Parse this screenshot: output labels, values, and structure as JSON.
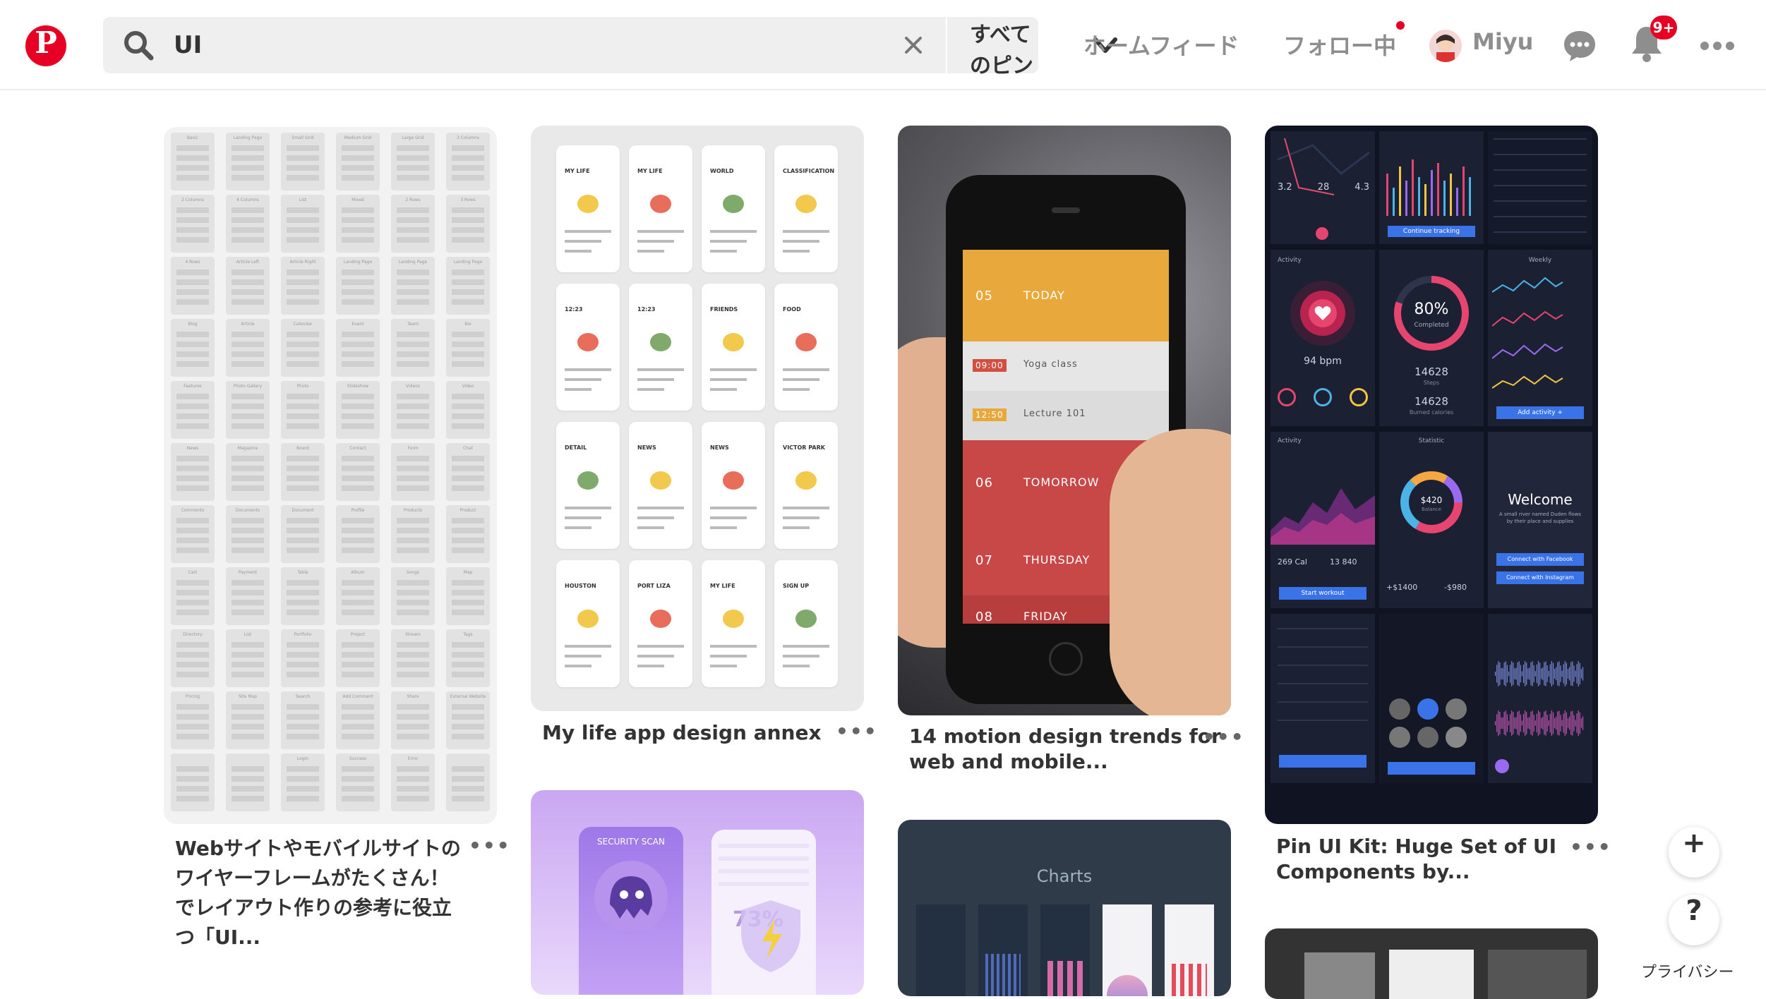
{
  "header": {
    "logo": "P",
    "search_value": "UI",
    "filter_label": "すべてのピン",
    "nav_home": "ホームフィード",
    "nav_following": "フォロー中",
    "user_name": "Miyu",
    "notification_badge": "9+"
  },
  "pins": [
    {
      "caption_lines": [
        "Webサイトやモバイルサイトの",
        "ワイヤーフレームがたくさん！",
        "でレイアウト作りの参考に役立",
        "つ「UI..."
      ]
    },
    {
      "caption": "My life app design annex"
    },
    {
      "caption_lines": [
        "14 motion design trends for",
        "web and mobile..."
      ]
    },
    {
      "caption_lines": [
        "Pin UI Kit: Huge Set of UI",
        "Components by..."
      ]
    }
  ],
  "phone_rows": [
    {
      "num": "05",
      "label": "TODAY"
    },
    {
      "time": "09:00",
      "label": "Yoga class"
    },
    {
      "time": "12:50",
      "label": "Lecture 101"
    },
    {
      "num": "06",
      "label": "TOMORROW"
    },
    {
      "num": "07",
      "label": "THURSDAY"
    },
    {
      "num": "08",
      "label": "FRIDAY"
    }
  ],
  "wireframe_labels": [
    [
      "Basic",
      "Landing Page",
      "Small Grid",
      "Medium Grid",
      "Large Grid",
      "3 Columns"
    ],
    [
      "2 Columns",
      "4 Columns",
      "List",
      "Mixed",
      "2 Rows",
      "3 Rows"
    ],
    [
      "4 Rows",
      "Article Left",
      "Article Right",
      "Landing Page",
      "Landing Page",
      "Landing Page"
    ],
    [
      "Blog",
      "Article",
      "Calendar",
      "Event",
      "Team",
      "Bio"
    ],
    [
      "Features",
      "Photo Gallery",
      "Photo",
      "Slideshow",
      "Videos",
      "Video"
    ],
    [
      "News",
      "Magazine",
      "Board",
      "Contact",
      "Form",
      "Chat"
    ],
    [
      "Comments",
      "Documents",
      "Document",
      "Profile",
      "Products",
      "Product"
    ],
    [
      "Cart",
      "Payment",
      "Table",
      "Album",
      "Songs",
      "Map"
    ],
    [
      "Directory",
      "List",
      "Portfolio",
      "Project",
      "Stream",
      "Tags"
    ],
    [
      "Pricing",
      "Site Map",
      "Search",
      "Add Comment",
      "Share",
      "External Website"
    ],
    [
      "",
      "",
      "Login",
      "Success",
      "Error",
      ""
    ]
  ],
  "life_labels": [
    [
      "MY LIFE",
      "MY LIFE",
      "WORLD",
      "CLASSIFICATION"
    ],
    [
      "12:23",
      "12:23",
      "FRIENDS",
      "FOOD"
    ],
    [
      "DETAIL",
      "NEWS",
      "NEWS",
      "VICTOR PARK"
    ],
    [
      "HOUSTON",
      "PORT LIZA",
      "MY LIFE",
      "SIGN UP"
    ]
  ],
  "dashboard": {
    "stats": [
      "3.2",
      "28",
      "4.3"
    ],
    "bpm": "94 bpm",
    "percent": "80%",
    "completed": "Completed",
    "steps": "14628",
    "steps_label": "Steps",
    "steps2": "14628",
    "calories_label": "Burned calories",
    "welcome": "Welcome",
    "welcome_sub": "A small river named Duden flows by their place and supplies",
    "facebook_btn": "Connect with Facebook",
    "instagram_btn": "Connect with Instagram",
    "continue_btn": "Continue tracking",
    "add_activity": "Add activity +",
    "start_workout": "Start workout",
    "amount": "$420",
    "balance": "Balance",
    "plus_amount": "+$1400",
    "minus_amount": "-$980",
    "activity": "Activity",
    "weekly": "Weekly",
    "statistic": "Statistic",
    "cal": "269 Cal",
    "cal_sub": "13 840"
  },
  "other": {
    "charts_title": "Charts",
    "security_title": "SECURITY SCAN",
    "pct": "73%"
  },
  "floating": {
    "plus": "+",
    "help": "?",
    "privacy": "プライバシー"
  }
}
